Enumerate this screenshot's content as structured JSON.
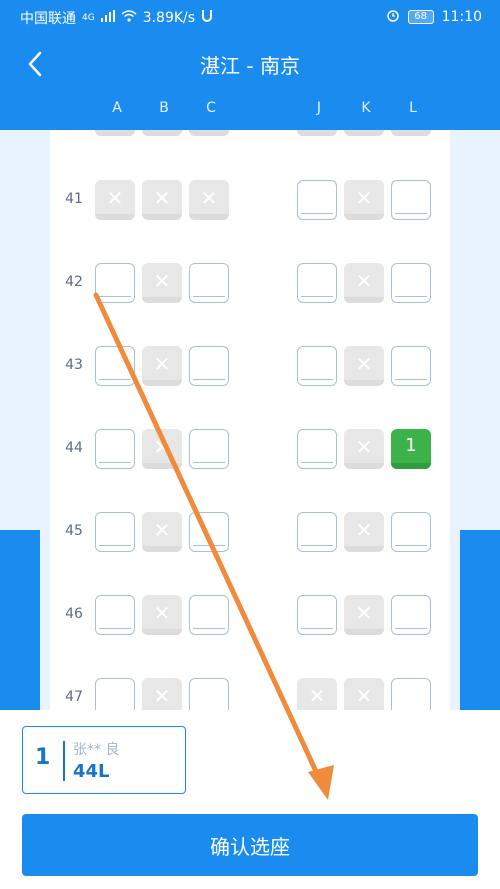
{
  "status_bar": {
    "carrier": "中国联通",
    "network": "4G",
    "speed": "3.89K/s",
    "battery": "68",
    "time": "11:10"
  },
  "header": {
    "title": "湛江 - 南京"
  },
  "columns": [
    "A",
    "B",
    "C",
    "J",
    "K",
    "L"
  ],
  "rows": [
    {
      "number": "41",
      "seats": [
        "taken",
        "taken",
        "taken",
        "available",
        "taken",
        "available"
      ]
    },
    {
      "number": "42",
      "seats": [
        "available",
        "taken",
        "available",
        "available",
        "taken",
        "available"
      ]
    },
    {
      "number": "43",
      "seats": [
        "available",
        "taken",
        "available",
        "available",
        "taken",
        "available"
      ]
    },
    {
      "number": "44",
      "seats": [
        "available",
        "taken",
        "available",
        "available",
        "taken",
        "selected"
      ]
    },
    {
      "number": "45",
      "seats": [
        "available",
        "taken",
        "available",
        "available",
        "taken",
        "available"
      ]
    },
    {
      "number": "46",
      "seats": [
        "available",
        "taken",
        "available",
        "available",
        "taken",
        "available"
      ]
    },
    {
      "number": "47",
      "seats": [
        "available",
        "taken",
        "available",
        "taken",
        "taken",
        "available"
      ]
    }
  ],
  "selected_label": "1",
  "passenger": {
    "index": "1",
    "name": "张** 良",
    "seat": "44L"
  },
  "confirm_label": "确认选座",
  "colors": {
    "brand": "#1a8cf0",
    "selected": "#3bb34a",
    "arrow": "#f08a3c"
  }
}
